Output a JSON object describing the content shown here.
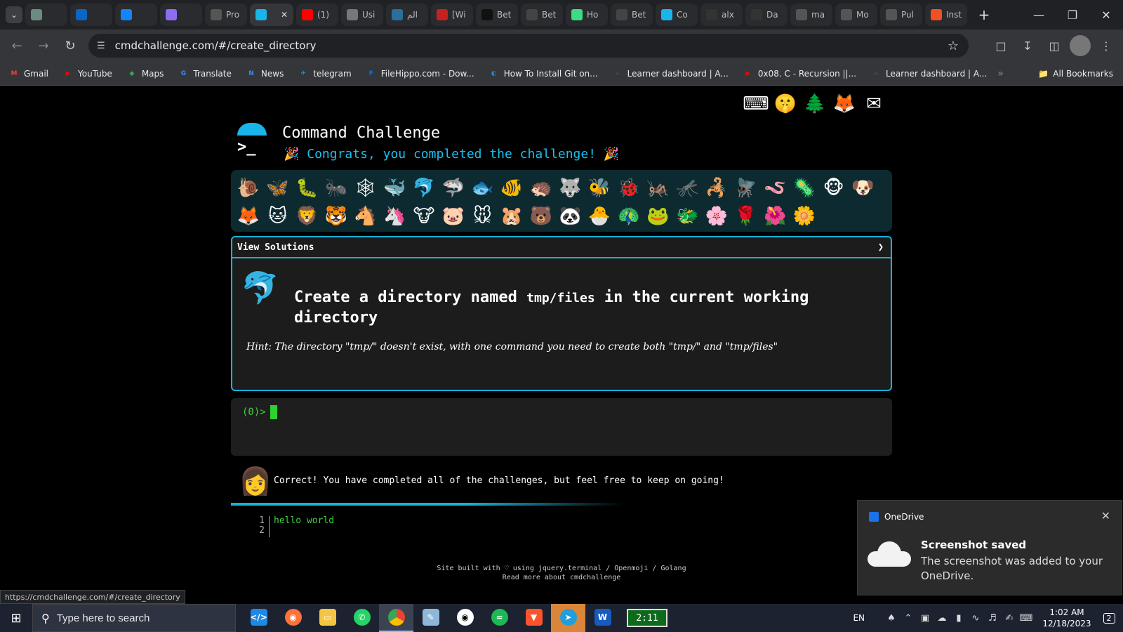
{
  "browser": {
    "tabs": [
      {
        "label": "",
        "icon": "openai",
        "color": "#6c8b80"
      },
      {
        "label": "",
        "icon": "linkedin",
        "color": "#0a66c2"
      },
      {
        "label": "",
        "icon": "butterfly",
        "color": "#1185fe"
      },
      {
        "label": "",
        "icon": "gemini",
        "color": "#8c6cf0"
      },
      {
        "label": "Pro",
        "icon": "alx",
        "color": "#555555"
      },
      {
        "label": "",
        "icon": "cmdchallenge",
        "color": "#19b5ea",
        "active": true
      },
      {
        "label": "(1)",
        "icon": "youtube",
        "color": "#ff0000"
      },
      {
        "label": "Usi",
        "icon": "globe",
        "color": "#777777"
      },
      {
        "label": "الم",
        "icon": "w-site",
        "color": "#2a6f9a"
      },
      {
        "label": "[Wi",
        "icon": "gmail",
        "color": "#c5221f"
      },
      {
        "label": "Bet",
        "icon": "betty",
        "color": "#111111"
      },
      {
        "label": "Bet",
        "icon": "betty2",
        "color": "#444444"
      },
      {
        "label": "Ho",
        "icon": "android",
        "color": "#3ddc84"
      },
      {
        "label": "Bet",
        "icon": "betty3",
        "color": "#444444"
      },
      {
        "label": "Co",
        "icon": "cmdchallenge2",
        "color": "#19b5ea"
      },
      {
        "label": "alx",
        "icon": "github",
        "color": "#333333"
      },
      {
        "label": "Da",
        "icon": "github2",
        "color": "#333333"
      },
      {
        "label": "ma",
        "icon": "copilot",
        "color": "#555555"
      },
      {
        "label": "Mo",
        "icon": "copilot2",
        "color": "#555555"
      },
      {
        "label": "Pul",
        "icon": "copilot3",
        "color": "#555555"
      },
      {
        "label": "Inst",
        "icon": "microsoft",
        "color": "#f25022"
      }
    ],
    "tab_close": "✕",
    "new_tab": "+",
    "url": "cmdchallenge.com/#/create_directory",
    "bookmarks": [
      {
        "label": "Gmail",
        "color": "#ea4335",
        "glyph": "M"
      },
      {
        "label": "YouTube",
        "color": "#ff0000",
        "glyph": "▶"
      },
      {
        "label": "Maps",
        "color": "#34a853",
        "glyph": "◆"
      },
      {
        "label": "Translate",
        "color": "#4285f4",
        "glyph": "G"
      },
      {
        "label": "News",
        "color": "#4285f4",
        "glyph": "N"
      },
      {
        "label": "telegram",
        "color": "#229ed9",
        "glyph": "✈"
      },
      {
        "label": "FileHippo.com - Dow...",
        "color": "#1b6ac9",
        "glyph": "F"
      },
      {
        "label": "How To Install Git on...",
        "color": "#1e88e5",
        "glyph": "◐"
      },
      {
        "label": "Learner dashboard | A...",
        "color": "#444444",
        "glyph": "a"
      },
      {
        "label": "0x08. C - Recursion ||...",
        "color": "#ff0000",
        "glyph": "▶"
      },
      {
        "label": "Learner dashboard | A...",
        "color": "#444444",
        "glyph": "a"
      }
    ],
    "all_bookmarks": "All Bookmarks"
  },
  "page": {
    "title": "Command Challenge",
    "congrats": "🎉 Congrats, you completed the challenge! 🎉",
    "top_icons": [
      "⌨",
      "🤫",
      "🌲",
      "🦊",
      "✉"
    ],
    "badges": [
      "🐌",
      "🦋",
      "🐛",
      "🐜",
      "🕸",
      "🐳",
      "🐬",
      "🦈",
      "🐟",
      "🐠",
      "🦔",
      "🐺",
      "🐝",
      "🐞",
      "🦗",
      "🦟",
      "🦂",
      "🪰",
      "🪱",
      "🦠",
      "🐵",
      "🐶",
      "🦊",
      "🐱",
      "🦁",
      "🐯",
      "🐴",
      "🦄",
      "🐮",
      "🐷",
      "🐭",
      "🐹",
      "🐻",
      "🐼",
      "🐣",
      "🦚",
      "🐸",
      "🐲",
      "🌸",
      "🌹",
      "🌺",
      "🌼"
    ],
    "view_solutions": "View Solutions",
    "chevron": "❯",
    "challenge_icon": "🐬",
    "challenge_pre": "Create a directory named ",
    "challenge_code": "tmp/files",
    "challenge_post": " in the current working directory",
    "hint": "Hint: The directory \"tmp/\" doesn't exist, with one command you need to create both \"tmp/\" and \"tmp/files\"",
    "prompt": "(0)>",
    "avatar": "👩",
    "correct_msg": "Correct! You have completed all of the challenges, but feel free to keep on going!",
    "editor_lines": [
      "1",
      "2"
    ],
    "editor_content": "hello world",
    "footer_line1": "Site built with ♡ using jquery.terminal / Openmoji / Golang",
    "footer_line2": "Read more about cmdchallenge"
  },
  "status_url": "https://cmdchallenge.com/#/create_directory",
  "toast": {
    "app": "OneDrive",
    "title": "Screenshot saved",
    "body": "The screenshot was added to your OneDrive."
  },
  "taskbar": {
    "search_placeholder": "Type here to search",
    "timer": "2:11",
    "lang": "EN",
    "time": "1:02 AM",
    "date": "12/18/2023",
    "notifications": "2"
  }
}
